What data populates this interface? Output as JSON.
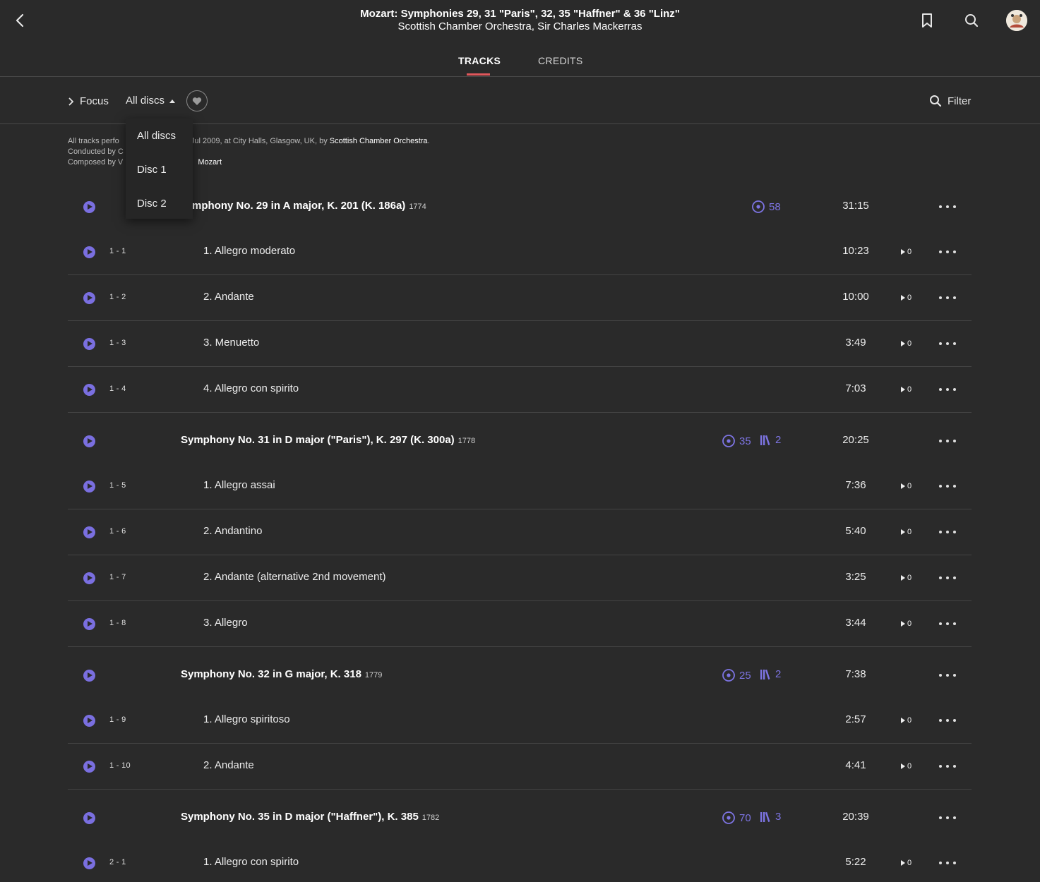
{
  "header": {
    "album_title": "Mozart: Symphonies 29, 31 \"Paris\", 32, 35 \"Haffner\" & 36 \"Linz\"",
    "album_artist": "Scottish Chamber Orchestra, Sir Charles Mackerras"
  },
  "tabs": [
    {
      "label": "TRACKS",
      "active": true
    },
    {
      "label": "CREDITS",
      "active": false
    }
  ],
  "toolbar": {
    "focus_label": "Focus",
    "discs_label": "All discs",
    "filter_label": "Filter"
  },
  "dropdown": {
    "options": [
      "All discs",
      "Disc 1",
      "Disc 2"
    ]
  },
  "info": {
    "line1_prefix": "All tracks perfo",
    "line1_suffix": "- 17 Jul 2009, at City Halls, Glasgow, UK, by",
    "line1_orchestra": "Scottish Chamber Orchestra",
    "line1_end": ".",
    "line2": "Conducted by C",
    "line3": "Composed by V",
    "line3_end": "Mozart"
  },
  "colors": {
    "accent": "#7a6fe0",
    "tab_underline": "#e0575b",
    "background": "#2a2a2a"
  },
  "works": [
    {
      "title": "Symphony No. 29 in A major, K. 201 (K. 186a)",
      "visible_title": "mphony No. 29 in A major, K. 201 (K. 186a)",
      "year": "1774",
      "listeners": "58",
      "libraries": null,
      "duration": "31:15",
      "tracks": [
        {
          "num": "1 - 1",
          "name": "1. Allegro moderato",
          "duration": "10:23",
          "plays": "0"
        },
        {
          "num": "1 - 2",
          "name": "2. Andante",
          "duration": "10:00",
          "plays": "0"
        },
        {
          "num": "1 - 3",
          "name": "3. Menuetto",
          "duration": "3:49",
          "plays": "0"
        },
        {
          "num": "1 - 4",
          "name": "4. Allegro con spirito",
          "duration": "7:03",
          "plays": "0"
        }
      ]
    },
    {
      "title": "Symphony No. 31 in D major (\"Paris\"), K. 297 (K. 300a)",
      "year": "1778",
      "listeners": "35",
      "libraries": "2",
      "duration": "20:25",
      "tracks": [
        {
          "num": "1 - 5",
          "name": "1. Allegro assai",
          "duration": "7:36",
          "plays": "0"
        },
        {
          "num": "1 - 6",
          "name": "2. Andantino",
          "duration": "5:40",
          "plays": "0"
        },
        {
          "num": "1 - 7",
          "name": "2. Andante (alternative 2nd movement)",
          "duration": "3:25",
          "plays": "0"
        },
        {
          "num": "1 - 8",
          "name": "3. Allegro",
          "duration": "3:44",
          "plays": "0"
        }
      ]
    },
    {
      "title": "Symphony No. 32 in G major, K. 318",
      "year": "1779",
      "listeners": "25",
      "libraries": "2",
      "duration": "7:38",
      "tracks": [
        {
          "num": "1 - 9",
          "name": "1. Allegro spiritoso",
          "duration": "2:57",
          "plays": "0"
        },
        {
          "num": "1 - 10",
          "name": "2. Andante",
          "duration": "4:41",
          "plays": "0"
        }
      ]
    },
    {
      "title": "Symphony No. 35 in D major (\"Haffner\"), K. 385",
      "year": "1782",
      "listeners": "70",
      "libraries": "3",
      "duration": "20:39",
      "tracks": [
        {
          "num": "2 - 1",
          "name": "1. Allegro con spirito",
          "duration": "5:22",
          "plays": "0"
        }
      ]
    }
  ]
}
